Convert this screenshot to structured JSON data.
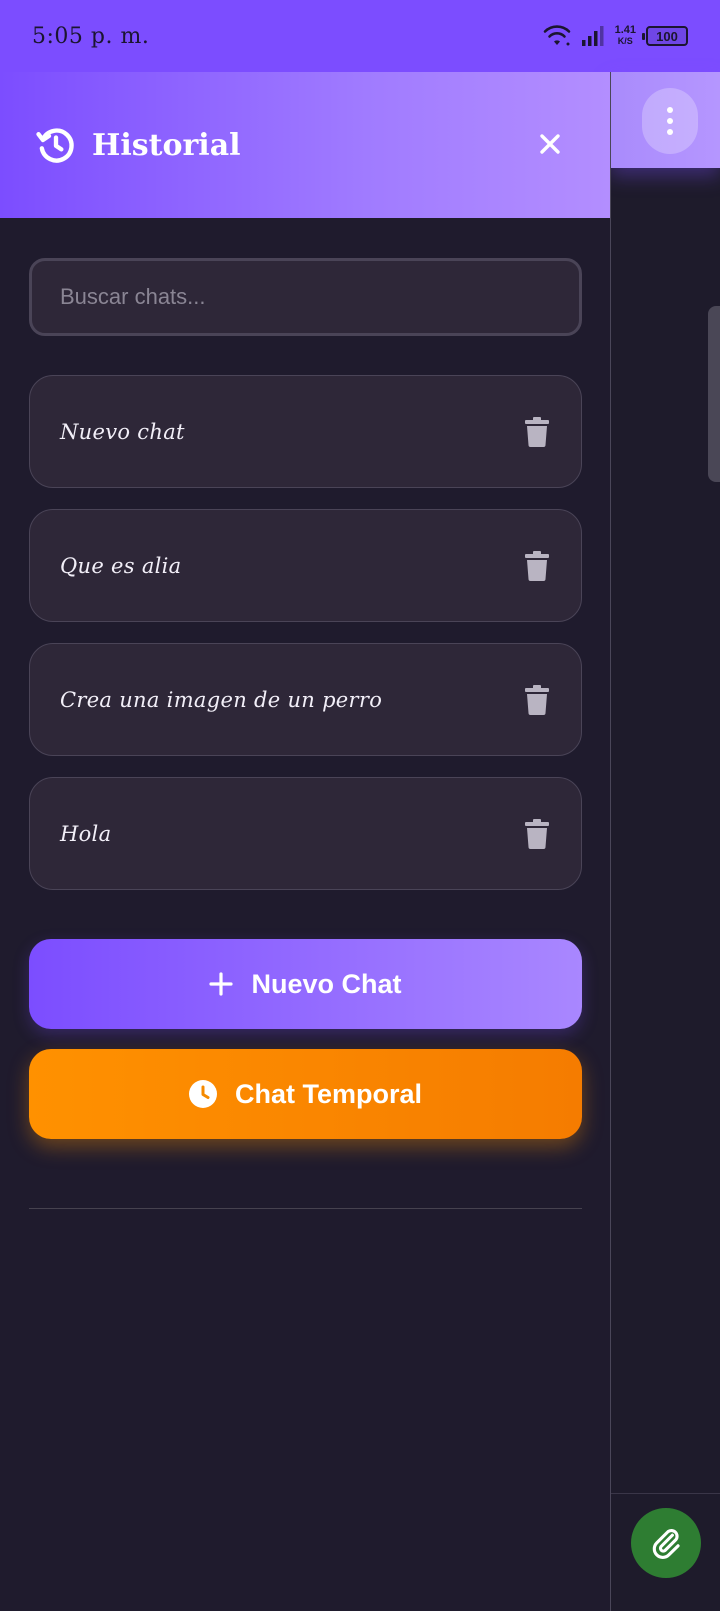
{
  "status_bar": {
    "time": "5:05 p. m.",
    "net_speed_value": "1.41",
    "net_speed_unit": "K/S",
    "battery": "100"
  },
  "drawer": {
    "title": "Historial",
    "search_placeholder": "Buscar chats...",
    "chats": [
      {
        "title": "Nuevo chat"
      },
      {
        "title": "Que es alia"
      },
      {
        "title": "Crea una imagen de un perro"
      },
      {
        "title": "Hola"
      }
    ],
    "new_chat_label": "Nuevo Chat",
    "temp_chat_label": "Chat Temporal"
  },
  "colors": {
    "accent": "#7c4dff",
    "accent_light": "#b38eff",
    "orange": "#ff9100",
    "attach_green": "#2e7d32",
    "background": "#1f1b2d"
  },
  "icons": {
    "header": "history-icon",
    "close": "close-icon",
    "delete": "trash-icon",
    "new_chat": "plus-icon",
    "temp_chat": "clock-icon",
    "menu": "more-vert-icon",
    "attach": "paperclip-icon"
  }
}
